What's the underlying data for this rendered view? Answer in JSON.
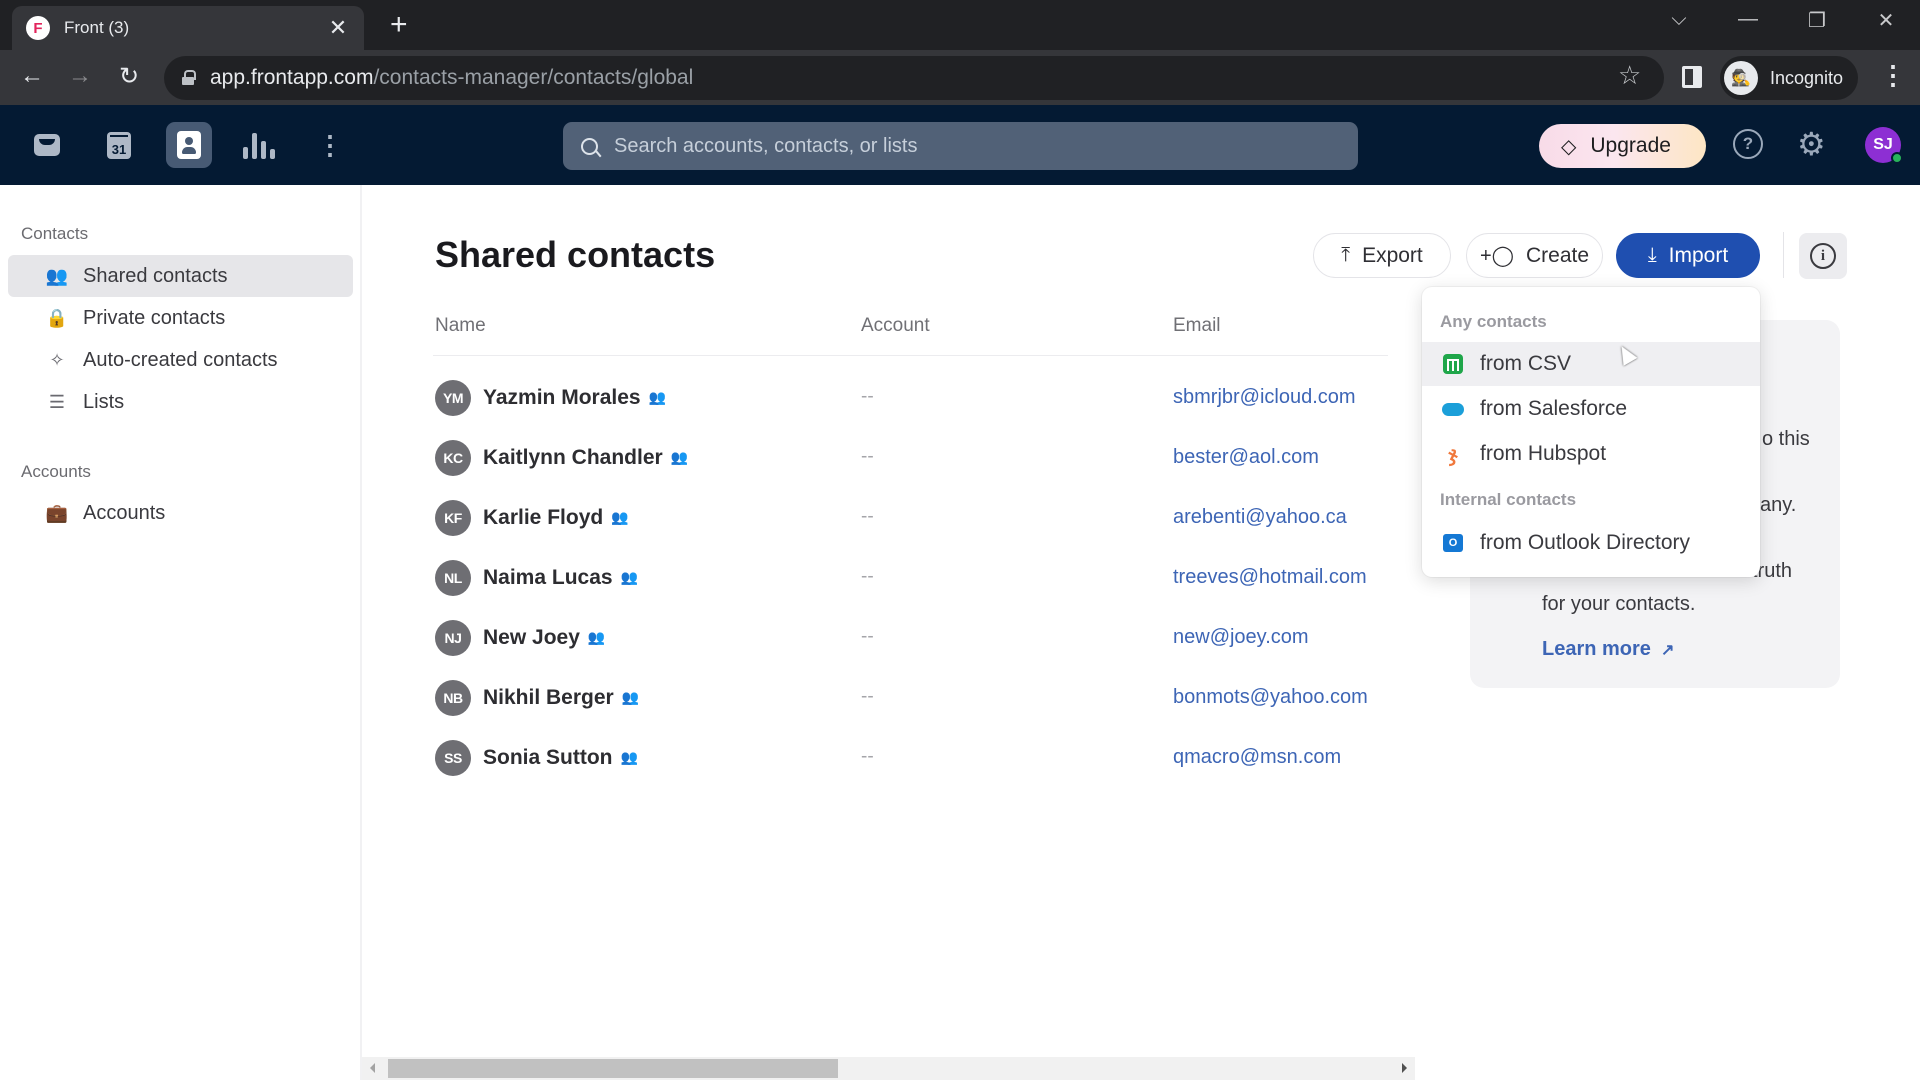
{
  "browser": {
    "tab_title": "Front (3)",
    "favicon_letter": "F",
    "url_host": "app.frontapp.com",
    "url_path": "/contacts-manager/contacts/global",
    "profile_label": "Incognito"
  },
  "app_header": {
    "nav_items": [
      {
        "name": "inbox",
        "icon": "inbox-icon"
      },
      {
        "name": "calendar",
        "icon": "calendar-icon",
        "text": "31"
      },
      {
        "name": "contacts",
        "icon": "contacts-icon",
        "active": true
      },
      {
        "name": "analytics",
        "icon": "bar-chart-icon"
      },
      {
        "name": "more",
        "icon": "more-vertical-icon"
      }
    ],
    "search_placeholder": "Search accounts, contacts, or lists",
    "upgrade_label": "Upgrade",
    "help_glyph": "?",
    "user_initials": "SJ",
    "avatar_color": "#8d2fd3",
    "presence_color": "#29b35b"
  },
  "sidebar": {
    "contacts_heading": "Contacts",
    "contacts_items": [
      {
        "label": "Shared contacts",
        "icon": "shared-users-icon",
        "active": true
      },
      {
        "label": "Private contacts",
        "icon": "lock-icon"
      },
      {
        "label": "Auto-created contacts",
        "icon": "sparkles-icon"
      },
      {
        "label": "Lists",
        "icon": "list-icon"
      }
    ],
    "accounts_heading": "Accounts",
    "accounts_items": [
      {
        "label": "Accounts",
        "icon": "briefcase-icon"
      }
    ]
  },
  "main": {
    "title": "Shared contacts",
    "actions": {
      "export_label": "Export",
      "create_label": "Create",
      "import_label": "Import"
    },
    "columns": [
      "Name",
      "Account",
      "Email"
    ],
    "rows": [
      {
        "initials": "YM",
        "name": "Yazmin Morales",
        "account": "--",
        "email": "sbmrjbr@icloud.com"
      },
      {
        "initials": "KC",
        "name": "Kaitlynn Chandler",
        "account": "--",
        "email": "bester@aol.com"
      },
      {
        "initials": "KF",
        "name": "Karlie Floyd",
        "account": "--",
        "email": "arebenti@yahoo.ca"
      },
      {
        "initials": "NL",
        "name": "Naima Lucas",
        "account": "--",
        "email": "treeves@hotmail.com"
      },
      {
        "initials": "NJ",
        "name": "New Joey",
        "account": "--",
        "email": "new@joey.com"
      },
      {
        "initials": "NB",
        "name": "Nikhil Berger",
        "account": "--",
        "email": "bonmots@yahoo.com"
      },
      {
        "initials": "SS",
        "name": "Sonia Sutton",
        "account": "--",
        "email": "qmacro@msn.com"
      }
    ]
  },
  "info_panel": {
    "visible_fragments": [
      "o this",
      "any.",
      "truth",
      "for your contacts."
    ],
    "learn_more_label": "Learn more"
  },
  "import_menu": {
    "group1_heading": "Any contacts",
    "group1_items": [
      {
        "label": "from CSV",
        "icon": "csv-icon",
        "hovered": true
      },
      {
        "label": "from Salesforce",
        "icon": "salesforce-icon"
      },
      {
        "label": "from Hubspot",
        "icon": "hubspot-icon"
      }
    ],
    "group2_heading": "Internal contacts",
    "group2_items": [
      {
        "label": "from Outlook Directory",
        "icon": "outlook-icon"
      }
    ]
  },
  "colors": {
    "header_bg": "#041a33",
    "primary": "#1f4fb0",
    "link": "#3d65b5"
  },
  "glyphs": {
    "close": "✕",
    "plus": "+",
    "back": "←",
    "forward": "→",
    "reload": "↻",
    "star": "☆",
    "chevron_down": "⌵",
    "minimize": "—",
    "restore": "❐",
    "kebab": "⋮",
    "gem": "◇",
    "gear": "⚙",
    "shared": "👥",
    "lock": "🔒",
    "sparkle": "✧",
    "list": "☰",
    "briefcase": "💼",
    "export": "⤒",
    "create": "+👤",
    "import": "⤓",
    "info": "i",
    "hubspot": "ჯ",
    "outlook": "O",
    "external": "↗",
    "incognito": "🕵",
    "dots": "⋮"
  }
}
